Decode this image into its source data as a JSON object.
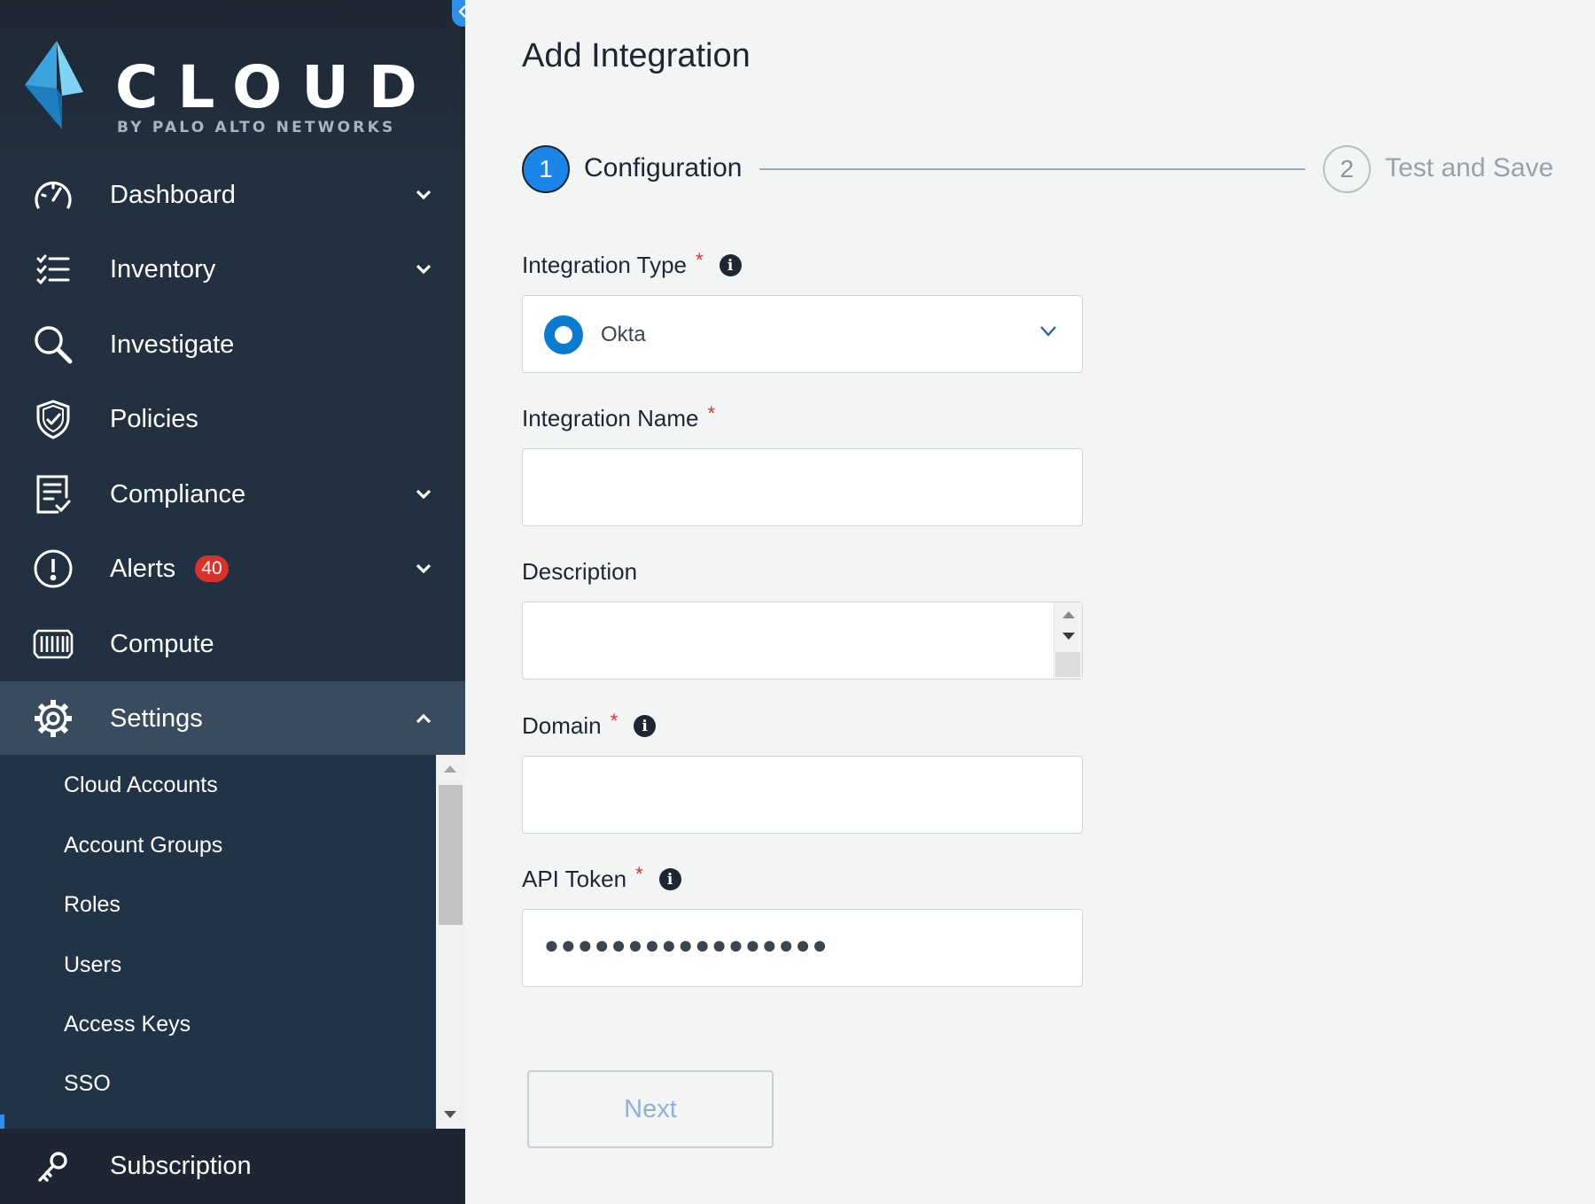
{
  "brand": {
    "wordmark": "CLOUD",
    "tagline": "BY PALO ALTO NETWORKS",
    "colors": {
      "sidebar": "#223244",
      "accent": "#1b86e8",
      "badge": "#d9322c"
    }
  },
  "sidebar": {
    "items": [
      {
        "label": "Dashboard",
        "icon": "gauge-icon",
        "expandable": true
      },
      {
        "label": "Inventory",
        "icon": "checklist-icon",
        "expandable": true
      },
      {
        "label": "Investigate",
        "icon": "search-icon",
        "expandable": false
      },
      {
        "label": "Policies",
        "icon": "shield-check-icon",
        "expandable": false
      },
      {
        "label": "Compliance",
        "icon": "report-check-icon",
        "expandable": true
      },
      {
        "label": "Alerts",
        "icon": "alert-circle-icon",
        "expandable": true,
        "badge": "40"
      },
      {
        "label": "Compute",
        "icon": "container-icon",
        "expandable": false
      },
      {
        "label": "Settings",
        "icon": "gear-icon",
        "expandable": true,
        "expanded": true
      }
    ],
    "settings_submenu": [
      "Cloud Accounts",
      "Account Groups",
      "Roles",
      "Users",
      "Access Keys",
      "SSO"
    ],
    "footer": {
      "label": "Subscription",
      "icon": "key-icon"
    }
  },
  "main": {
    "title": "Add Integration",
    "stepper": {
      "steps": [
        {
          "number": "1",
          "label": "Configuration",
          "active": true
        },
        {
          "number": "2",
          "label": "Test and Save",
          "active": false
        }
      ]
    },
    "form": {
      "integration_type": {
        "label": "Integration Type",
        "required": "*",
        "value": "Okta",
        "icon": "okta-logo-icon"
      },
      "integration_name": {
        "label": "Integration Name",
        "required": "*",
        "value": ""
      },
      "description": {
        "label": "Description",
        "value": ""
      },
      "domain": {
        "label": "Domain",
        "required": "*",
        "value": ""
      },
      "api_token": {
        "label": "API Token",
        "required": "*",
        "masked_value": "●●●●●●●●●●●●●●●●●"
      }
    },
    "next_label": "Next"
  }
}
